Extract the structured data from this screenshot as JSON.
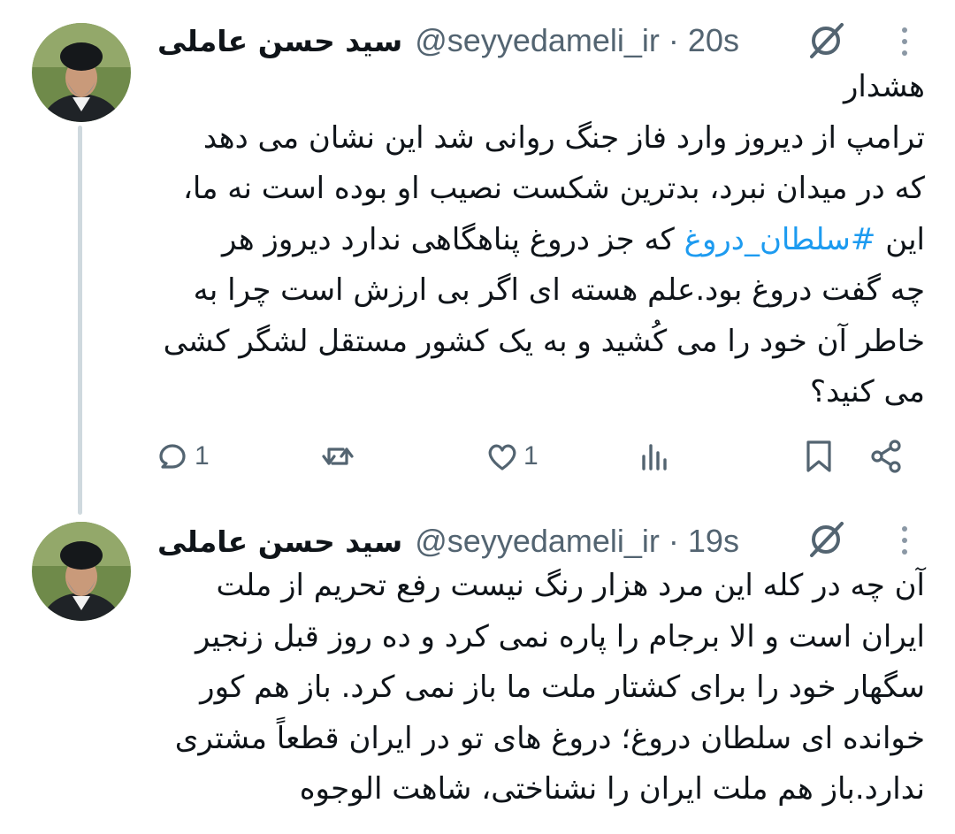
{
  "tweets": [
    {
      "display_name": "سید حسن عاملی",
      "handle": "@seyyedameli_ir",
      "time": "· 20s",
      "lines": [
        "هشدار",
        "ترامپ از دیروز وارد فاز جنگ روانی شد این نشان می دهد",
        "که در میدان نبرد، بدترین شکست نصیب او بوده است نه ما،",
        "چه گفت دروغ بود.علم هسته ای اگر بی ارزش است چرا به",
        "خاطر آن خود را می کُشید و به یک کشور مستقل لشگر کشی",
        "می کنید؟"
      ],
      "hashtag_line": {
        "before": "این ",
        "hashtag": "#سلطان_دروغ",
        "after": " که جز دروغ پناهگاهی ندارد دیروز هر"
      },
      "replies": "1",
      "likes": "1"
    },
    {
      "display_name": "سید حسن عاملی",
      "handle": "@seyyedameli_ir",
      "time": "· 19s",
      "lines": [
        "آن چه در کله این مرد هزار رنگ نیست رفع تحریم از ملت",
        "ایران است و الا برجام را پاره نمی کرد و ده روز قبل زنجیر",
        "سگهار خود را برای کشتار ملت ما باز نمی کرد. باز هم کور",
        "خوانده ای سلطان دروغ؛ دروغ های تو در ایران قطعاً مشتری",
        "ندارد.باز هم ملت ایران را نشناختی، شاهت الوجوه"
      ]
    }
  ],
  "colors": {
    "text": "#0f1419",
    "secondary": "#536471",
    "link": "#1d9bf0",
    "thread_line": "#cfd9de"
  },
  "icons": [
    "grok-icon",
    "more-icon",
    "reply-icon",
    "retweet-icon",
    "like-icon",
    "views-icon",
    "bookmark-icon",
    "share-icon"
  ]
}
